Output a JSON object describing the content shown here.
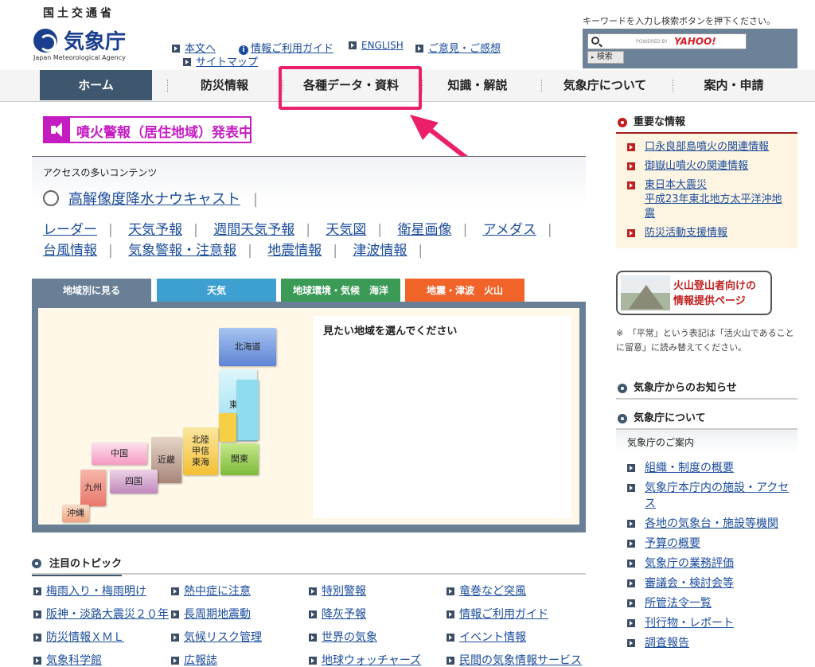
{
  "header": {
    "logo_top": "国土交通省",
    "logo_main": "気象庁",
    "logo_en": "Japan Meteorological Agency",
    "utility": {
      "honbun": "本文へ",
      "guide": "情報ご利用ガイド",
      "english": "ENGLISH",
      "opinion": "ご意見・ご感想",
      "sitemap": "サイトマップ"
    },
    "search": {
      "note": "キーワードを入力し検索ボタンを押下ください。",
      "powered_by": "POWERED BY",
      "provider": "YAHOO!",
      "button": "検索"
    }
  },
  "nav": {
    "items": [
      "ホーム",
      "防災情報",
      "各種データ・資料",
      "知識・解説",
      "気象庁について",
      "案内・申請"
    ]
  },
  "alert": {
    "text": "噴火警報（居住地域）発表中"
  },
  "access": {
    "title": "アクセスの多いコンテンツ",
    "nowcast": "高解像度降水ナウキャスト",
    "row1": [
      "レーダー",
      "天気予報",
      "週間天気予報",
      "天気図",
      "衛星画像",
      "アメダス"
    ],
    "row2": [
      "台風情報",
      "気象警報・注意報",
      "地震情報",
      "津波情報"
    ]
  },
  "region_tabs": {
    "tabs": [
      "地域別に見る",
      "天気",
      "地球環境・気候　海洋",
      "地震・津波　火山"
    ],
    "colors": [
      "#687f96",
      "#3ea0d0",
      "#3b9a56",
      "#f0642a"
    ]
  },
  "map": {
    "prompt": "見たい地域を選んでください",
    "regions": {
      "hokkaido": "北海道",
      "tohoku": "東北",
      "kanto": "関東",
      "hokuriku": "北陸\n甲信\n東海",
      "kinki": "近畿",
      "chugoku": "中国",
      "shikoku": "四国",
      "kyushu": "九州",
      "okinawa": "沖縄"
    }
  },
  "topics": {
    "title": "注目のトピック",
    "col1": [
      "梅雨入り・梅雨明け",
      "阪神・淡路大震災２０年",
      "防災情報ＸＭＬ",
      "気象科学館"
    ],
    "col2": [
      "熱中症に注意",
      "長周期地震動",
      "気候リスク管理",
      "広報誌"
    ],
    "col3": [
      "特別警報",
      "降灰予報",
      "世界の気象",
      "地球ウォッチャーズ"
    ],
    "col4": [
      "竜巻など突風",
      "情報ご利用ガイド",
      "イベント情報",
      "民間の気象情報サービス"
    ]
  },
  "right": {
    "important_title": "重要な情報",
    "important_items": [
      "口永良部島噴火の関連情報",
      "御嶽山噴火の関連情報",
      "東日本大震災\n平成23年東北地方太平洋沖地震",
      "防災活動支援情報"
    ],
    "volcano_banner": "火山登山者向けの\n情報提供ページ",
    "note": "※　「平常」という表記は「活火山であることに留意」に読み替えてください。",
    "notice_title": "気象庁からのお知らせ",
    "about_title": "気象庁について",
    "about_sub": "気象庁のご案内",
    "about_items": [
      "組織・制度の概要",
      "気象庁本庁内の施設・アクセス",
      "各地の気象台・施設等機関",
      "予算の概要",
      "気象庁の業務評価",
      "審議会・検討会等",
      "所管法令一覧",
      "刊行物・レポート",
      "調査報告"
    ]
  }
}
